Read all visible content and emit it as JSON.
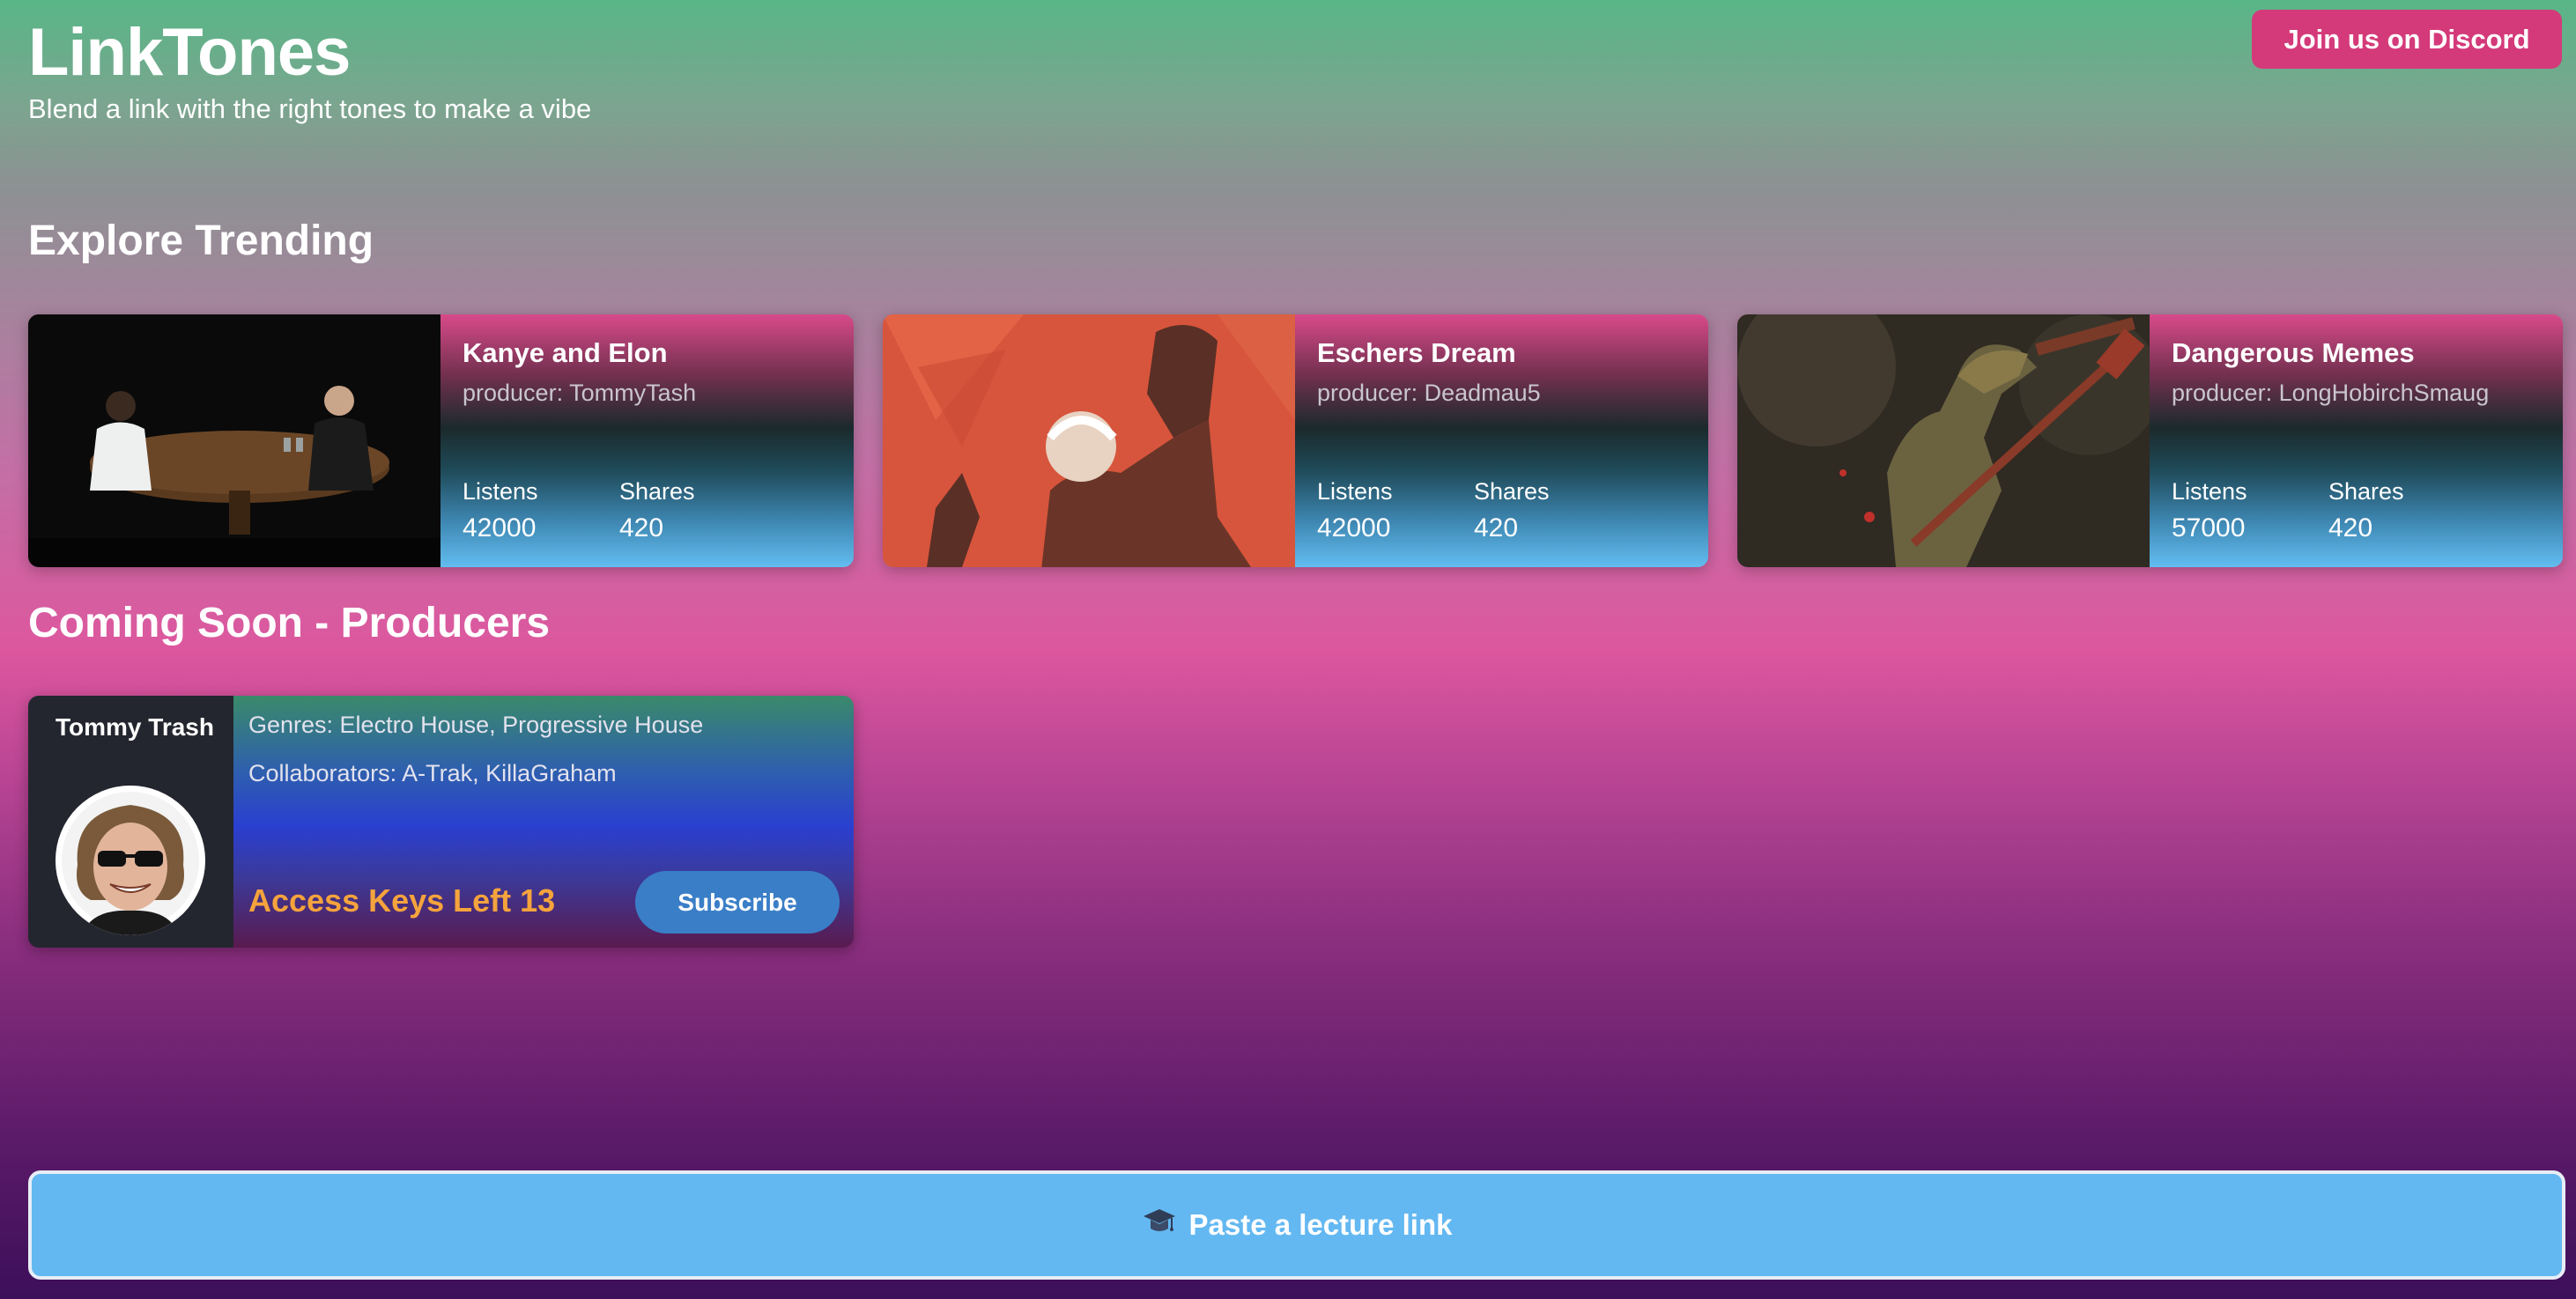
{
  "app": {
    "title": "LinkTones",
    "subtitle": "Blend a link with the right tones to make a vibe",
    "discord_label": "Join us on Discord"
  },
  "sections": {
    "trending_title": "Explore Trending",
    "producers_title": "Coming Soon - Producers"
  },
  "trending": [
    {
      "name": "Kanye and Elon",
      "producer": "producer: TommyTash",
      "listens_label": "Listens",
      "listens": "42000",
      "shares_label": "Shares",
      "shares": "420"
    },
    {
      "name": "Eschers Dream",
      "producer": "producer: Deadmau5",
      "listens_label": "Listens",
      "listens": "42000",
      "shares_label": "Shares",
      "shares": "420"
    },
    {
      "name": "Dangerous Memes",
      "producer": "producer: LongHobirchSmaug",
      "listens_label": "Listens",
      "listens": "57000",
      "shares_label": "Shares",
      "shares": "420"
    }
  ],
  "producer": {
    "name": "Tommy Trash",
    "genres": "Genres: Electro House, Progressive House",
    "collaborators": "Collaborators: A-Trak, KillaGraham",
    "access_keys": "Access Keys Left 13",
    "subscribe_label": "Subscribe"
  },
  "paste": {
    "icon": "graduation-cap-icon",
    "label": "Paste a lecture link"
  }
}
